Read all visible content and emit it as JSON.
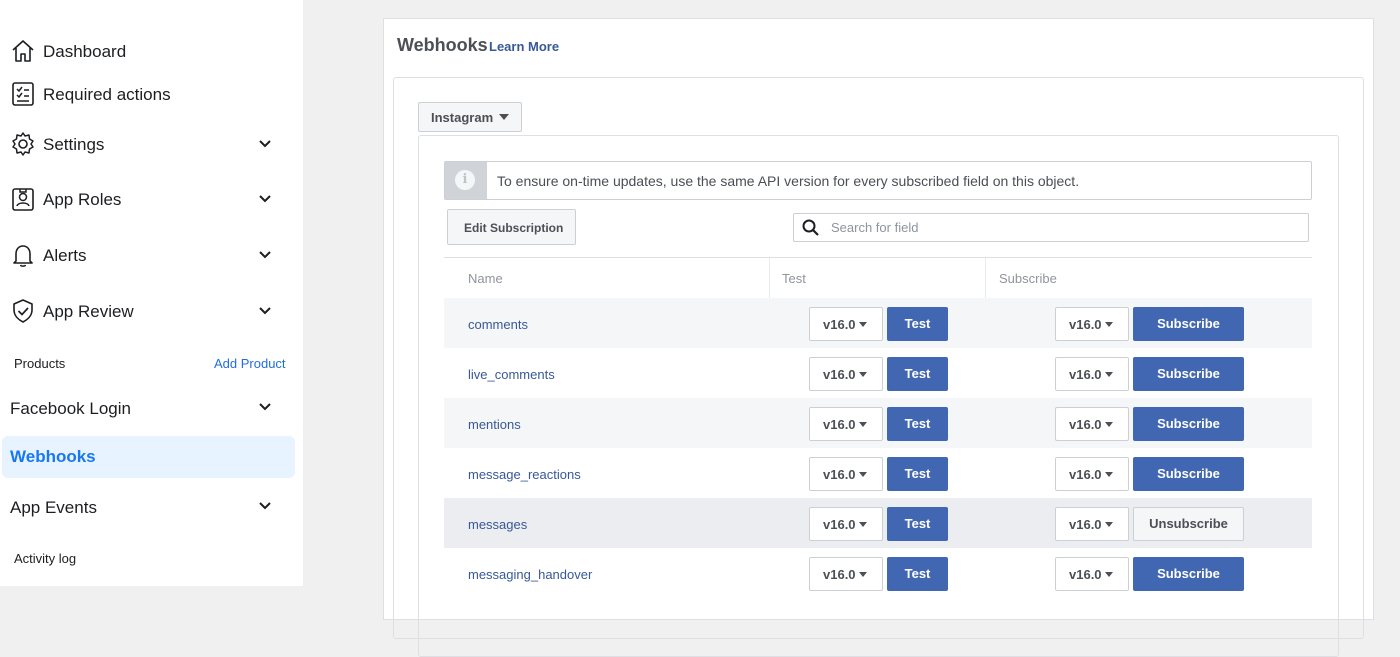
{
  "sidebar": {
    "items": [
      {
        "label": "Dashboard",
        "icon": "home-icon"
      },
      {
        "label": "Required actions",
        "icon": "checklist-icon"
      },
      {
        "label": "Settings",
        "icon": "gear-icon"
      },
      {
        "label": "App Roles",
        "icon": "badge-icon"
      },
      {
        "label": "Alerts",
        "icon": "bell-icon"
      },
      {
        "label": "App Review",
        "icon": "shield-check-icon"
      }
    ],
    "products_label": "Products",
    "add_product": "Add Product",
    "products": [
      {
        "label": "Facebook Login"
      },
      {
        "label": "Webhooks"
      },
      {
        "label": "App Events"
      }
    ],
    "activity_log": "Activity log"
  },
  "panel": {
    "title": "Webhooks",
    "learn_more": "Learn More",
    "object_select": "Instagram",
    "notice": "To ensure on-time updates, use the same API version for every subscribed field on this object.",
    "edit_subscription": "Edit Subscription",
    "search_placeholder": "Search for field",
    "columns": {
      "name": "Name",
      "test": "Test",
      "subscribe": "Subscribe"
    },
    "rows": [
      {
        "field": "comments",
        "test_version": "v16.0",
        "test_label": "Test",
        "sub_version": "v16.0",
        "sub_label": "Subscribe",
        "subscribed": false
      },
      {
        "field": "live_comments",
        "test_version": "v16.0",
        "test_label": "Test",
        "sub_version": "v16.0",
        "sub_label": "Subscribe",
        "subscribed": false
      },
      {
        "field": "mentions",
        "test_version": "v16.0",
        "test_label": "Test",
        "sub_version": "v16.0",
        "sub_label": "Subscribe",
        "subscribed": false
      },
      {
        "field": "message_reactions",
        "test_version": "v16.0",
        "test_label": "Test",
        "sub_version": "v16.0",
        "sub_label": "Subscribe",
        "subscribed": false
      },
      {
        "field": "messages",
        "test_version": "v16.0",
        "test_label": "Test",
        "sub_version": "v16.0",
        "sub_label": "Unsubscribe",
        "subscribed": true
      },
      {
        "field": "messaging_handover",
        "test_version": "v16.0",
        "test_label": "Test",
        "sub_version": "v16.0",
        "sub_label": "Subscribe",
        "subscribed": false
      }
    ]
  },
  "colors": {
    "primary_button": "#4267b2",
    "active_nav_bg": "#e7f3ff",
    "active_nav_text": "#1877f2",
    "link": "#385898",
    "row_stripe": "#f5f6f7",
    "row_subscribed": "#ebedf0"
  }
}
